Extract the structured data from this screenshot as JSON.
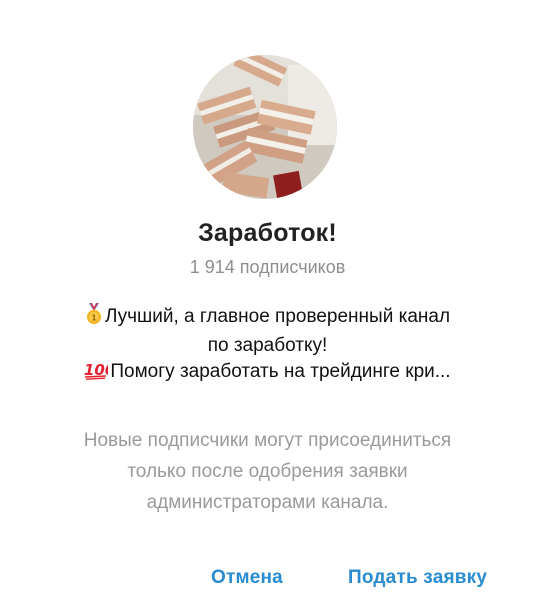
{
  "channel": {
    "title": "Заработок!",
    "subscribers": "1 914 подписчиков",
    "avatar_icon": "cash-stacks-photo"
  },
  "description": {
    "line1_emoji": "medal-icon",
    "line1": "Лучший, а главное проверенный канал",
    "line2": "по заработку!",
    "line3_emoji": "hundred-points-icon",
    "line3": "Помогу заработать на трейдинге кри..."
  },
  "notice": {
    "line1": "Новые подписчики могут присоединиться",
    "line2": "только после одобрения заявки",
    "line3": "администраторами канала."
  },
  "actions": {
    "cancel_label": "Отмена",
    "apply_label": "Подать заявку"
  },
  "colors": {
    "accent": "#2a8cd0",
    "secondary_text": "#8e8e8e"
  }
}
